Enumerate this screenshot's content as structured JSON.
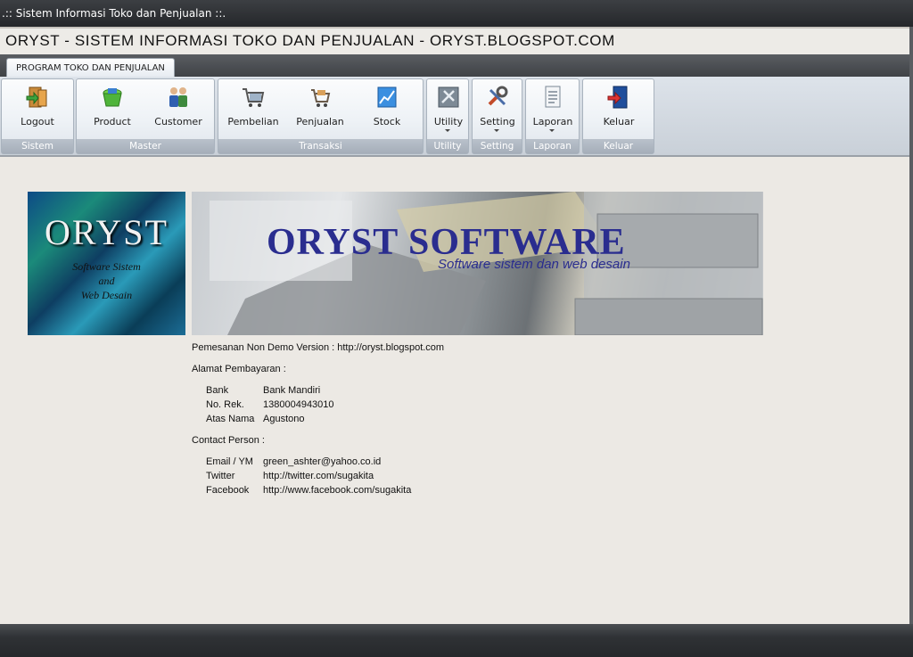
{
  "window": {
    "title": ".:: Sistem Informasi Toko dan Penjualan ::."
  },
  "heading": "ORYST - SISTEM INFORMASI TOKO DAN PENJUALAN - ORYST.BLOGSPOT.COM",
  "tab": "PROGRAM TOKO DAN PENJUALAN",
  "ribbon": {
    "groups": [
      {
        "caption": "Sistem",
        "buttons": [
          {
            "label": "Logout",
            "icon": "exit-door-icon"
          }
        ]
      },
      {
        "caption": "Master",
        "buttons": [
          {
            "label": "Product",
            "icon": "basket-icon"
          },
          {
            "label": "Customer",
            "icon": "users-icon"
          }
        ]
      },
      {
        "caption": "Transaksi",
        "buttons": [
          {
            "label": "Pembelian",
            "icon": "cart-icon"
          },
          {
            "label": "Penjualan",
            "icon": "cart-small-icon"
          },
          {
            "label": "Stock",
            "icon": "chart-icon"
          }
        ]
      },
      {
        "caption": "Utility",
        "buttons": [
          {
            "label": "Utility",
            "icon": "tools-icon"
          }
        ]
      },
      {
        "caption": "Setting",
        "buttons": [
          {
            "label": "Setting",
            "icon": "wrench-icon"
          }
        ]
      },
      {
        "caption": "Laporan",
        "buttons": [
          {
            "label": "Laporan",
            "icon": "report-icon"
          }
        ]
      },
      {
        "caption": "Keluar",
        "buttons": [
          {
            "label": "Keluar",
            "icon": "exit-icon"
          }
        ]
      }
    ]
  },
  "logo": {
    "title": "ORYST",
    "subtitle_1": "Software Sistem",
    "subtitle_2": "and",
    "subtitle_3": "Web Desain"
  },
  "banner": {
    "title": "ORYST SOFTWARE",
    "subtitle": "Software sistem dan web desain"
  },
  "info": {
    "order_line": "Pemesanan Non Demo Version :   http://oryst.blogspot.com",
    "payment_heading": "Alamat Pembayaran :",
    "payment": [
      {
        "key": "Bank",
        "value": "Bank Mandiri"
      },
      {
        "key": "No. Rek.",
        "value": "1380004943010"
      },
      {
        "key": "Atas Nama",
        "value": "Agustono"
      }
    ],
    "contact_heading": "Contact Person :",
    "contact": [
      {
        "key": "Email / YM",
        "value": "green_ashter@yahoo.co.id"
      },
      {
        "key": "Twitter",
        "value": "http://twitter.com/sugakita"
      },
      {
        "key": "Facebook",
        "value": "http://www.facebook.com/sugakita"
      }
    ]
  },
  "colors": {
    "titlebar": "#2e3134",
    "banner_text": "#2a2d8f",
    "ribbon_caption": "#a5aeb9"
  }
}
